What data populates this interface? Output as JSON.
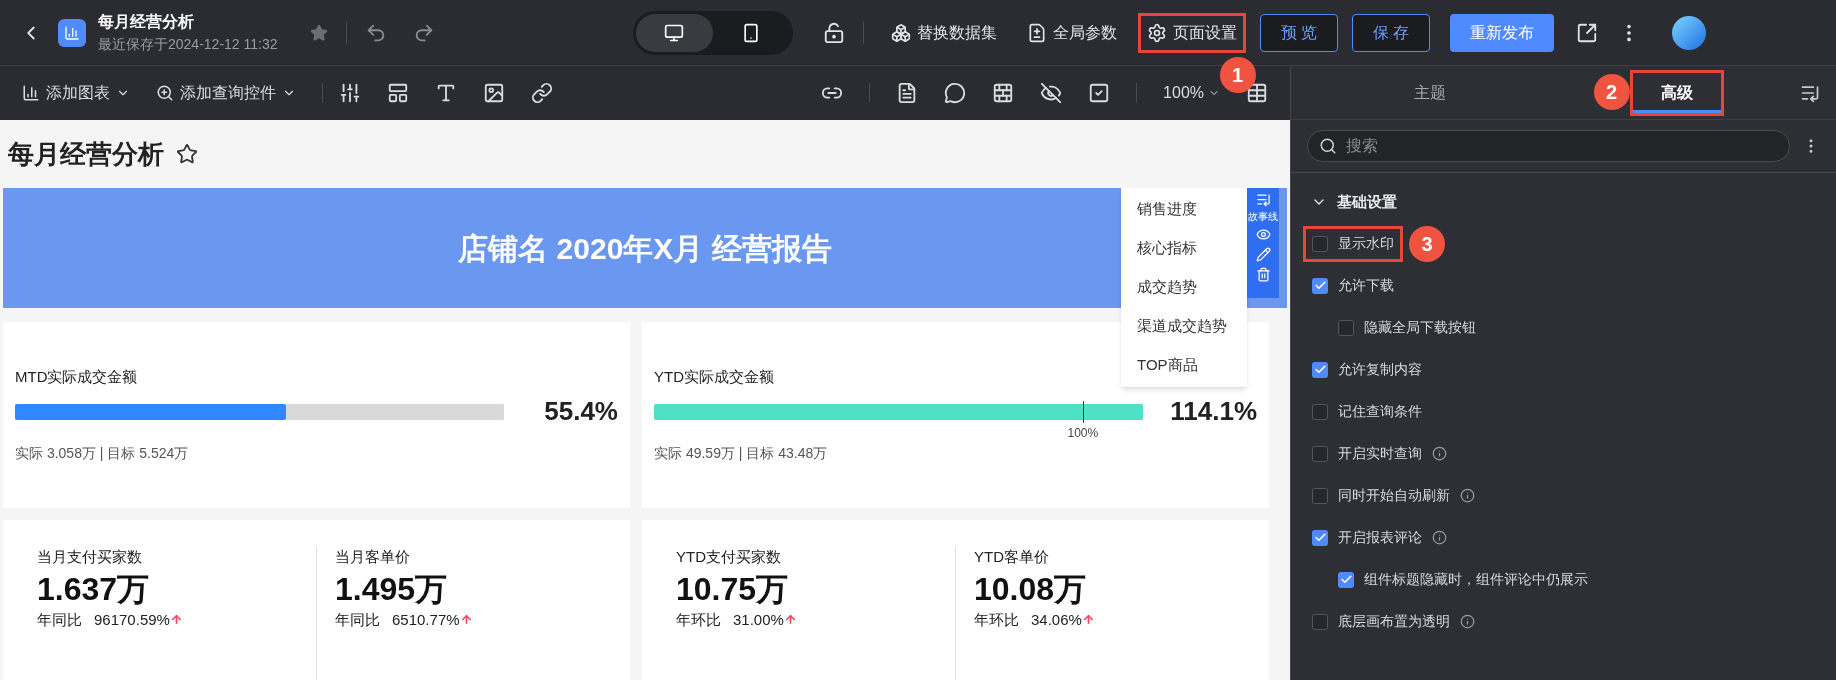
{
  "header": {
    "title": "每月经营分析",
    "saved": "最近保存于2024-12-12 11:32",
    "device_toggle": [
      {
        "kind": "desktop",
        "selected": true
      },
      {
        "kind": "mobile",
        "selected": false
      }
    ],
    "actions": [
      {
        "label": "替换数据集",
        "kind": "dataset",
        "highlighted": false
      },
      {
        "label": "全局参数",
        "kind": "params",
        "highlighted": false
      },
      {
        "label": "页面设置",
        "kind": "settings",
        "highlighted": true,
        "callout": "1"
      }
    ],
    "buttons": [
      {
        "label": "预 览",
        "kind": "outline"
      },
      {
        "label": "保 存",
        "kind": "outline"
      },
      {
        "label": "重新发布",
        "kind": "primary"
      }
    ]
  },
  "toolbar": {
    "menus": [
      {
        "label": "添加图表",
        "kind": "chart"
      },
      {
        "label": "添加查询控件",
        "kind": "query"
      }
    ],
    "zoom": "100%"
  },
  "canvas": {
    "page_title": "每月经营分析",
    "banner": {
      "title": "店铺名 2020年X月 经营报告"
    },
    "story_nav": {
      "label": "故事线",
      "items": [
        "销售进度",
        "核心指标",
        "成交趋势",
        "渠道成交趋势",
        "TOP商品"
      ]
    },
    "progress_cards": [
      {
        "title": "MTD实际成交金额",
        "level": 0.554,
        "percent": "55.4%",
        "color": "#2f88ff",
        "detail": "实际 3.058万 | 目标 5.524万"
      },
      {
        "title": "YTD实际成交金额",
        "level": 1,
        "percent": "114.1%",
        "color": "#4fe0c8",
        "detail": "实际 49.59万 | 目标 43.48万",
        "marker": {
          "label": "100%",
          "level": 0.877
        }
      }
    ],
    "kpi_cards": [
      {
        "metrics": [
          {
            "title": "当月支付买家数",
            "value": "1.637万",
            "compare_label": "年同比",
            "compare_value": "96170.59%"
          },
          {
            "title": "当月客单价",
            "value": "1.495万",
            "compare_label": "年同比",
            "compare_value": "6510.77%"
          }
        ]
      },
      {
        "metrics": [
          {
            "title": "YTD支付买家数",
            "value": "10.75万",
            "compare_label": "年环比",
            "compare_value": "31.00%"
          },
          {
            "title": "YTD客单价",
            "value": "10.08万",
            "compare_label": "年环比",
            "compare_value": "34.06%"
          }
        ]
      }
    ]
  },
  "side_panel": {
    "tabs": [
      {
        "label": "主题",
        "selected": false,
        "highlighted": false
      },
      {
        "label": "高级",
        "selected": true,
        "highlighted": true,
        "callout": "2"
      }
    ],
    "search": {
      "placeholder": "搜索"
    },
    "section": {
      "title": "基础设置",
      "expanded": true
    },
    "options": [
      {
        "label": "显示水印",
        "checked": false,
        "info": false,
        "highlighted": true,
        "callout": "3"
      },
      {
        "label": "允许下载",
        "checked": true,
        "info": false,
        "highlighted": false,
        "children": [
          {
            "label": "隐藏全局下载按钮",
            "checked": false,
            "info": false,
            "highlighted": false
          }
        ]
      },
      {
        "label": "允许复制内容",
        "checked": true,
        "info": false,
        "highlighted": false
      },
      {
        "label": "记住查询条件",
        "checked": false,
        "info": false,
        "highlighted": false
      },
      {
        "label": "开启实时查询",
        "checked": false,
        "info": true,
        "highlighted": false
      },
      {
        "label": "同时开始自动刷新",
        "checked": false,
        "info": true,
        "highlighted": false
      },
      {
        "label": "开启报表评论",
        "checked": true,
        "info": true,
        "highlighted": false,
        "children": [
          {
            "label": "组件标题隐藏时，组件评论中仍展示",
            "checked": true,
            "info": false,
            "highlighted": false
          }
        ]
      },
      {
        "label": "底层画布置为透明",
        "checked": false,
        "info": true,
        "highlighted": false
      }
    ]
  }
}
